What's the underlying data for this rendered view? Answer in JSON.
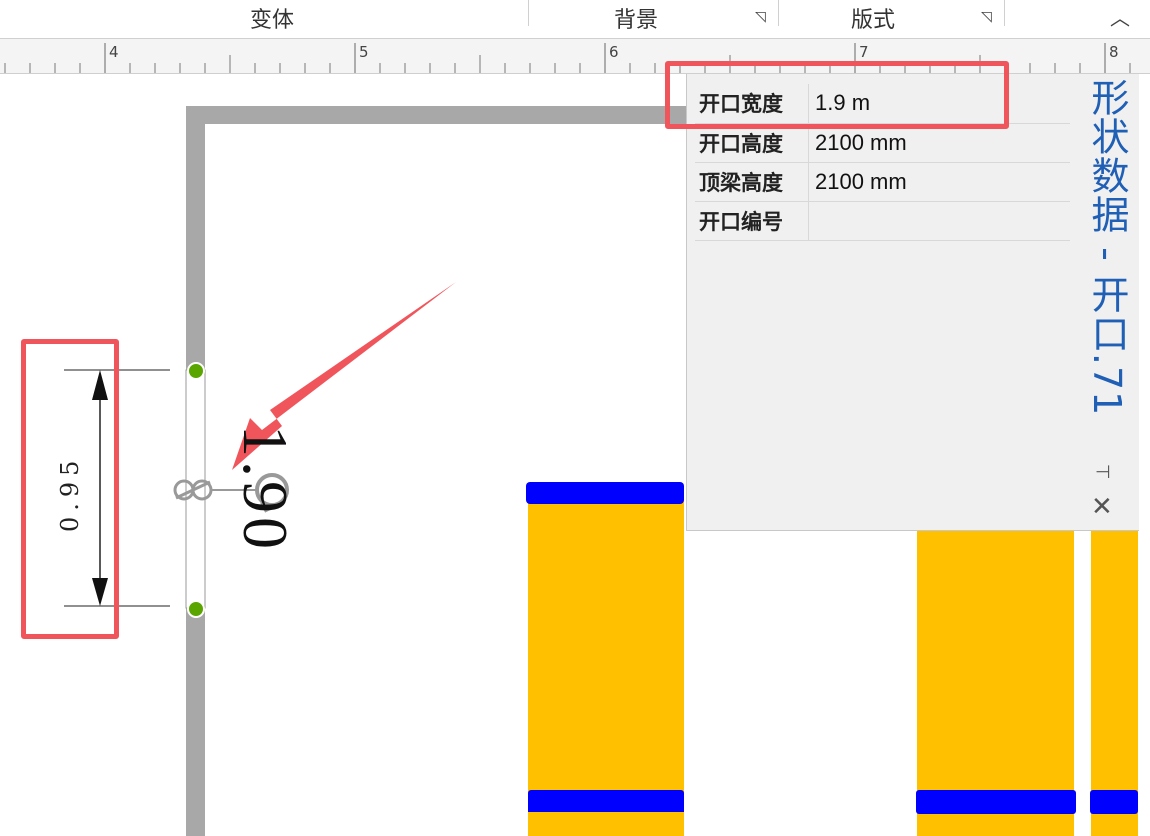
{
  "ribbon": {
    "groups": [
      {
        "label": "变体"
      },
      {
        "label": "背景"
      },
      {
        "label": "版式"
      }
    ]
  },
  "ruler": {
    "labels": [
      "4",
      "5",
      "6",
      "7",
      "8"
    ]
  },
  "shape_data_panel": {
    "title": "形状数据 - 开口.71",
    "rows": [
      {
        "key": "开口宽度",
        "value": "1.9 m"
      },
      {
        "key": "开口高度",
        "value": "2100 mm"
      },
      {
        "key": "顶梁高度",
        "value": "2100 mm"
      },
      {
        "key": "开口编号",
        "value": ""
      }
    ],
    "pin_icon": "pin-icon",
    "close_icon": "close-icon"
  },
  "drawing": {
    "dimension_value": "0.95",
    "opening_label": "1.90"
  },
  "colors": {
    "highlight": "#f0555b",
    "title_blue": "#1f5fb5",
    "rack_yellow": "#ffc000",
    "rack_blue": "#0000ff",
    "wall_gray": "#a8a8a8",
    "handle_green": "#5aa500"
  }
}
